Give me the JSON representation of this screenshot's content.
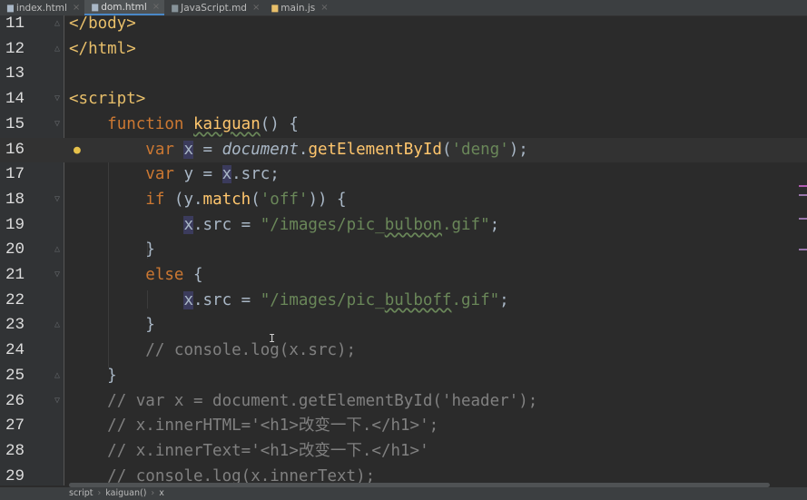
{
  "tabs": [
    {
      "label": "index.html",
      "type": "html",
      "active": false
    },
    {
      "label": "dom.html",
      "type": "html",
      "active": true
    },
    {
      "label": "JavaScript.md",
      "type": "md",
      "active": false
    },
    {
      "label": "main.js",
      "type": "js",
      "active": false
    }
  ],
  "current_line": 16,
  "lines": [
    {
      "n": "11",
      "fold": "end",
      "html": "<span class=\"tag\">&lt;/body&gt;</span>"
    },
    {
      "n": "12",
      "fold": "end",
      "html": "<span class=\"tag\">&lt;/html&gt;</span>"
    },
    {
      "n": "13",
      "fold": "",
      "html": ""
    },
    {
      "n": "14",
      "fold": "start",
      "html": "<span class=\"tag\">&lt;script&gt;</span>"
    },
    {
      "n": "15",
      "fold": "start",
      "html": "    <span class=\"kw\">function</span> <span class=\"fn sq\">kaiguan</span>() {"
    },
    {
      "n": "16",
      "fold": "",
      "bulb": true,
      "html": "        <span class=\"kw\">var</span> <span class=\"hl\">x</span> = <span class=\"it\">document</span>.<span class=\"meth\">getElementById</span>(<span class=\"str\">'deng'</span>);"
    },
    {
      "n": "17",
      "fold": "",
      "html": "        <span class=\"kw\">var</span> y = <span class=\"hl\">x</span>.src;"
    },
    {
      "n": "18",
      "fold": "start",
      "html": "        <span class=\"kw\">if</span> (y.<span class=\"meth\">match</span>(<span class=\"str\">'off'</span>)) {"
    },
    {
      "n": "19",
      "fold": "",
      "html": "            <span class=\"hl\">x</span>.src = <span class=\"str\">\"/images/pic_<span class=\"sq\">bulbon</span>.gif\"</span>;"
    },
    {
      "n": "20",
      "fold": "end",
      "html": "        }"
    },
    {
      "n": "21",
      "fold": "start",
      "html": "        <span class=\"kw\">else</span> {"
    },
    {
      "n": "22",
      "fold": "",
      "html": "            <span class=\"hl\">x</span>.src = <span class=\"str\">\"/images/pic_<span class=\"sq\">bulboff</span>.gif\"</span>;"
    },
    {
      "n": "23",
      "fold": "end",
      "html": "        }"
    },
    {
      "n": "24",
      "fold": "",
      "html": "        <span class=\"cmt\">// console.log(x.src);</span>"
    },
    {
      "n": "25",
      "fold": "end",
      "html": "    }"
    },
    {
      "n": "26",
      "fold": "start",
      "html": "    <span class=\"cmt\">// var x = document.getElementById('header');</span>"
    },
    {
      "n": "27",
      "fold": "",
      "html": "    <span class=\"cmt\">// x.innerHTML='&lt;h1&gt;改变一下.&lt;/h1&gt;';</span>"
    },
    {
      "n": "28",
      "fold": "",
      "html": "    <span class=\"cmt\">// x.innerText='&lt;h1&gt;改变一下.&lt;/h1&gt;'</span>"
    },
    {
      "n": "29",
      "fold": "",
      "html": "    <span class=\"cmt\">// console.log(x.innerText);</span>"
    }
  ],
  "breadcrumb": [
    "script",
    "kaiguan()",
    "x"
  ],
  "colors": {
    "keyword": "#cc7832",
    "string": "#6a8759",
    "comment": "#808080",
    "function": "#ffc66d",
    "tag": "#e8bf6a",
    "background": "#2b2b2b"
  }
}
